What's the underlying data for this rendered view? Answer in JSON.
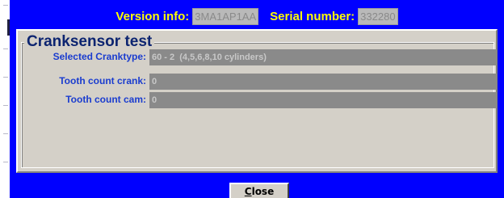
{
  "header": {
    "version_label": "Version info:",
    "version_value": "3MA1AP1AA",
    "serial_label": "Serial number:",
    "serial_value": "332280"
  },
  "group": {
    "title": "Cranksensor test"
  },
  "fields": [
    {
      "label": "Selected Cranktype:",
      "value": "60 - 2  (4,5,6,8,10 cylinders)"
    },
    {
      "label": "Tooth count crank:",
      "value": "0"
    },
    {
      "label": "Tooth count cam:",
      "value": "0"
    }
  ],
  "buttons": {
    "close_first": "C",
    "close_rest": "lose"
  },
  "colors": {
    "dialog_bg": "#0000ff",
    "header_label": "#ffff00",
    "panel_bg": "#d4d0c8",
    "field_label": "#1a3ccf",
    "field_value_bg": "#8a8a8a"
  }
}
